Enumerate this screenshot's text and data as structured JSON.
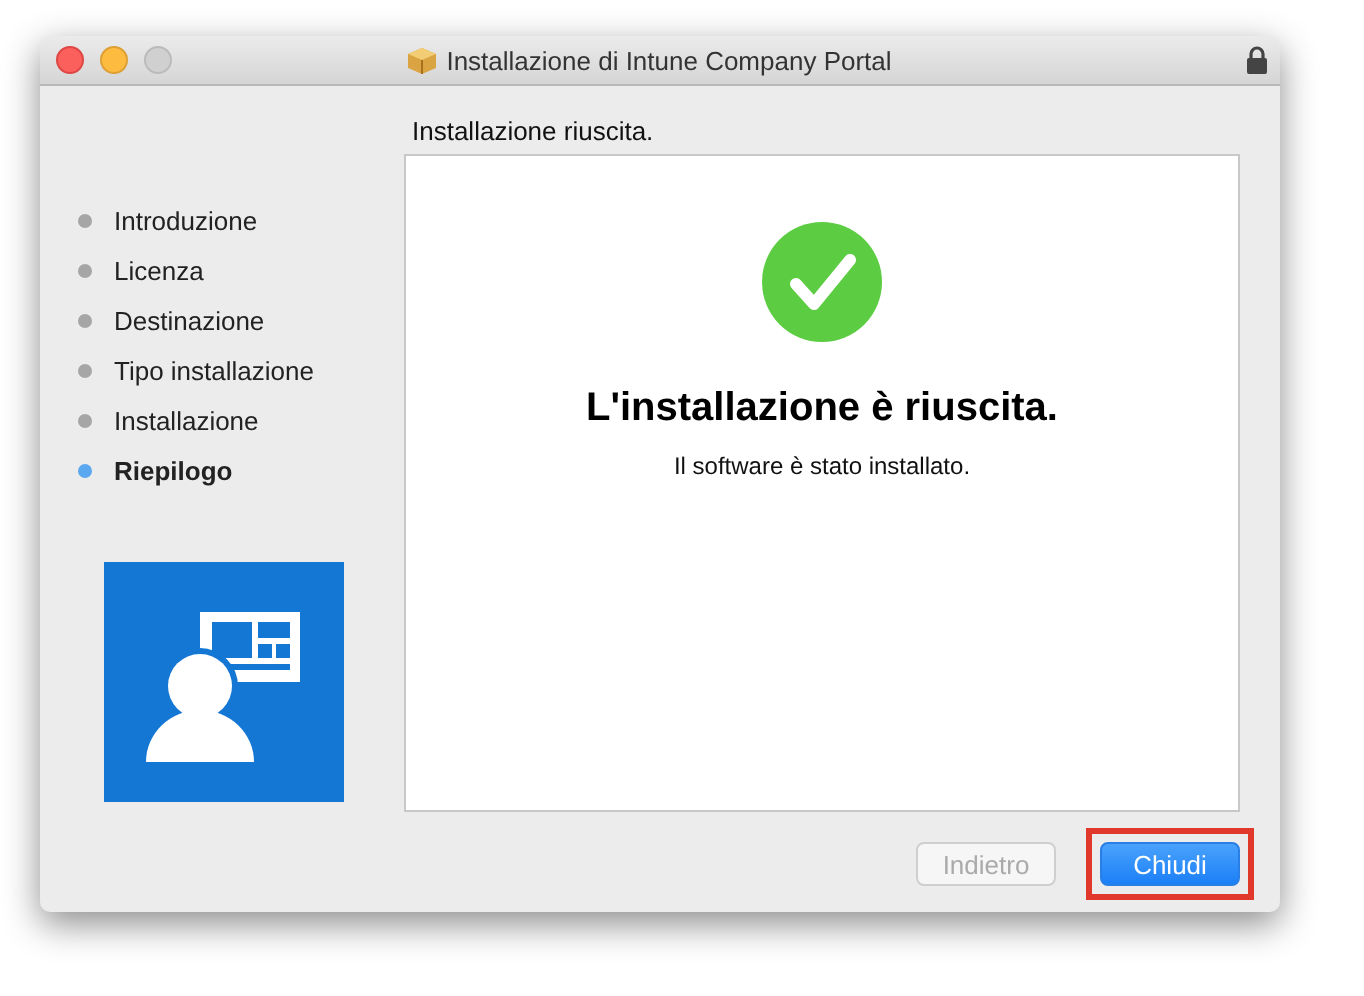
{
  "window": {
    "title": "Installazione di Intune Company Portal"
  },
  "steps": [
    {
      "label": "Introduzione",
      "selected": false
    },
    {
      "label": "Licenza",
      "selected": false
    },
    {
      "label": "Destinazione",
      "selected": false
    },
    {
      "label": "Tipo installazione",
      "selected": false
    },
    {
      "label": "Installazione",
      "selected": false
    },
    {
      "label": "Riepilogo",
      "selected": true
    }
  ],
  "page_heading": "Installazione riuscita.",
  "result": {
    "title": "L'installazione è riuscita.",
    "message": "Il software è stato installato."
  },
  "buttons": [
    {
      "label": "Indietro",
      "disabled": true,
      "kind": "secondary",
      "highlighted": false
    },
    {
      "label": "Chiudi",
      "disabled": false,
      "kind": "primary",
      "highlighted": true
    }
  ]
}
